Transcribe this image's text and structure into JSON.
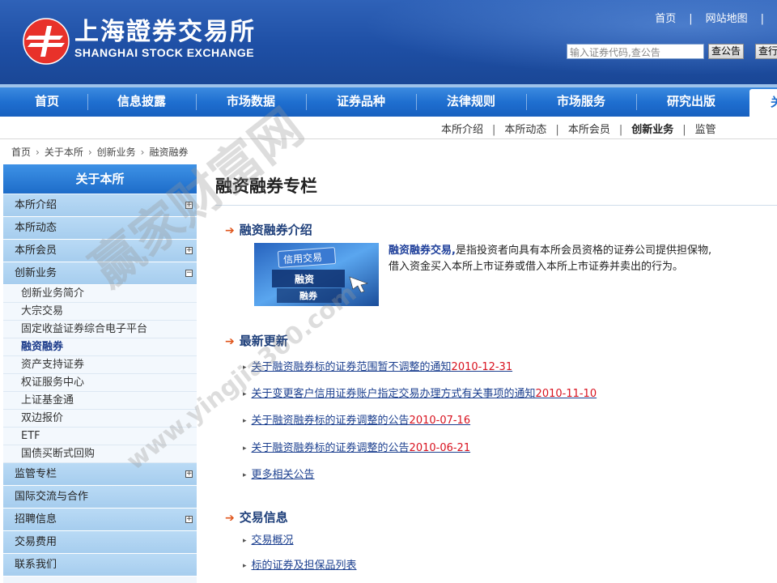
{
  "header": {
    "logo_cn": "上海證券交易所",
    "logo_en": "SHANGHAI STOCK EXCHANGE",
    "top_links": [
      "首页",
      "网站地图"
    ],
    "search_placeholder": "输入证券代码,查公告",
    "search_button": "查公告",
    "search_button2": "查行"
  },
  "main_nav": {
    "items": [
      "首页",
      "信息披露",
      "市场数据",
      "证券品种",
      "法律规则",
      "市场服务",
      "研究出版"
    ],
    "active_partial": "关"
  },
  "sub_nav": {
    "items": [
      "本所介绍",
      "本所动态",
      "本所会员",
      "创新业务",
      "监管"
    ],
    "current": "创新业务"
  },
  "breadcrumb": [
    "首页",
    "关于本所",
    "创新业务",
    "融资融券"
  ],
  "sidebar": {
    "title": "关于本所",
    "items": [
      {
        "label": "本所介绍",
        "expand": "+"
      },
      {
        "label": "本所动态",
        "expand": ""
      },
      {
        "label": "本所会员",
        "expand": "+"
      },
      {
        "label": "创新业务",
        "expand": "−"
      }
    ],
    "sub_items": [
      "创新业务简介",
      "大宗交易",
      "固定收益证券综合电子平台",
      "融资融券",
      "资产支持证券",
      "权证服务中心",
      "上证基金通",
      "双边报价",
      "ETF",
      "国债买断式回购"
    ],
    "active_sub": "融资融券",
    "items_after": [
      {
        "label": "监管专栏",
        "expand": "+"
      },
      {
        "label": "国际交流与合作",
        "expand": ""
      },
      {
        "label": "招聘信息",
        "expand": "+"
      },
      {
        "label": "交易费用",
        "expand": ""
      },
      {
        "label": "联系我们",
        "expand": ""
      }
    ]
  },
  "content": {
    "title": "融资融券专栏",
    "sections": {
      "intro_heading": "融资融券介绍",
      "intro_lead": "融资融券交易,",
      "intro_text_1": "是指投资者向具有本所会员资格的证券公司提供担保物,",
      "intro_text_2": "借入资金买入本所上市证券或借入本所上市证券并卖出的行为。",
      "intro_image": {
        "title": "信用交易",
        "label1": "融资",
        "label2": "融券"
      },
      "news_heading": "最新更新",
      "news": [
        {
          "text": "关于融资融券标的证券范围暂不调整的通知",
          "date": "2010-12-31"
        },
        {
          "text": "关于变更客户信用证券账户指定交易办理方式有关事项的通知",
          "date": "2010-11-10"
        },
        {
          "text": "关于融资融券标的证券调整的公告",
          "date": "2010-07-16"
        },
        {
          "text": "关于融资融券标的证券调整的公告",
          "date": "2010-06-21"
        }
      ],
      "news_more": "更多相关公告",
      "trade_heading": "交易信息",
      "trade_items": [
        "交易概况",
        "标的证券及担保品列表"
      ]
    }
  },
  "watermark": {
    "cn": "赢家财富网",
    "url": "www.yingjia360.com"
  },
  "colors": {
    "header_blue": "#1e4fa5",
    "nav_blue": "#1f6fd0",
    "link": "#1b3f8f",
    "date_red": "#d8121f",
    "arrow_orange": "#e0561c"
  }
}
